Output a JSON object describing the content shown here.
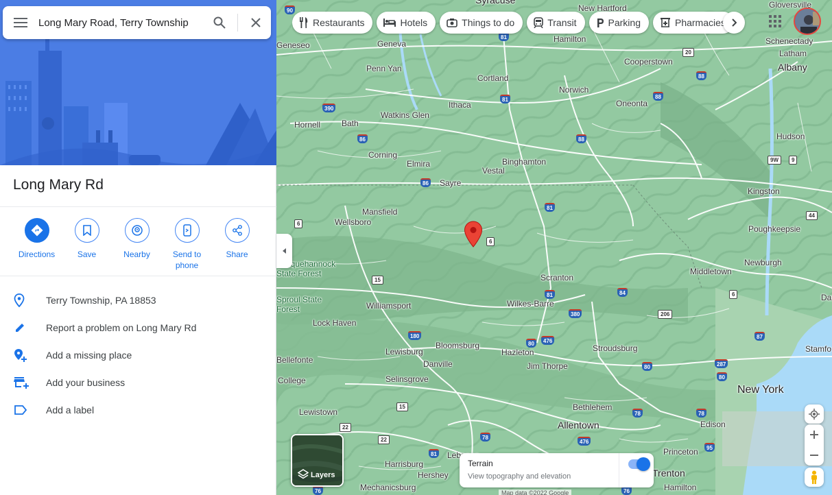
{
  "search": {
    "query": "Long Mary Road, Terry Township"
  },
  "place": {
    "title": "Long Mary Rd",
    "actions": [
      {
        "label": "Directions",
        "icon": "directions-icon"
      },
      {
        "label": "Save",
        "icon": "bookmark-icon"
      },
      {
        "label": "Nearby",
        "icon": "nearby-icon"
      },
      {
        "label": "Send to phone",
        "icon": "phone-icon"
      },
      {
        "label": "Share",
        "icon": "share-icon"
      }
    ],
    "info": [
      {
        "text": "Terry Township, PA 18853",
        "icon": "location-pin-icon"
      },
      {
        "text": "Report a problem on Long Mary Rd",
        "icon": "edit-pencil-icon"
      },
      {
        "text": "Add a missing place",
        "icon": "add-place-icon"
      },
      {
        "text": "Add your business",
        "icon": "add-business-icon"
      },
      {
        "text": "Add a label",
        "icon": "label-icon"
      }
    ]
  },
  "chips": [
    {
      "label": "Restaurants",
      "icon": "restaurant-icon"
    },
    {
      "label": "Hotels",
      "icon": "hotel-icon"
    },
    {
      "label": "Things to do",
      "icon": "camera-icon"
    },
    {
      "label": "Transit",
      "icon": "transit-icon"
    },
    {
      "label": "Parking",
      "icon": "parking-icon"
    },
    {
      "label": "Pharmacies",
      "icon": "pharmacy-icon"
    }
  ],
  "map": {
    "layers_label": "Layers",
    "terrain": {
      "title": "Terrain",
      "subtitle": "View topography and elevation",
      "enabled": true
    },
    "attribution": "Map data ©2022 Google",
    "places": [
      {
        "name": "Syracuse",
        "size": "med"
      },
      {
        "name": "New Hartford",
        "size": "small"
      },
      {
        "name": "Gloversville",
        "size": "small"
      },
      {
        "name": "Geneseo",
        "size": "small"
      },
      {
        "name": "Geneva",
        "size": "small"
      },
      {
        "name": "Hamilton",
        "size": "small"
      },
      {
        "name": "Schenectady",
        "size": "small"
      },
      {
        "name": "Latham",
        "size": "small"
      },
      {
        "name": "Albany",
        "size": "med"
      },
      {
        "name": "Penn Yan",
        "size": "small"
      },
      {
        "name": "Cooperstown",
        "size": "small"
      },
      {
        "name": "Cortland",
        "size": "small"
      },
      {
        "name": "Norwich",
        "size": "small"
      },
      {
        "name": "Ithaca",
        "size": "small"
      },
      {
        "name": "Oneonta",
        "size": "small"
      },
      {
        "name": "Watkins Glen",
        "size": "small"
      },
      {
        "name": "Hornell",
        "size": "small"
      },
      {
        "name": "Bath",
        "size": "small"
      },
      {
        "name": "Hudson",
        "size": "small"
      },
      {
        "name": "Corning",
        "size": "small"
      },
      {
        "name": "Binghamton",
        "size": "small"
      },
      {
        "name": "Elmira",
        "size": "small"
      },
      {
        "name": "Vestal",
        "size": "small"
      },
      {
        "name": "Sayre",
        "size": "small"
      },
      {
        "name": "Kingston",
        "size": "small"
      },
      {
        "name": "Mansfield",
        "size": "small"
      },
      {
        "name": "Wellsboro",
        "size": "small"
      },
      {
        "name": "Poughkeepsie",
        "size": "small"
      },
      {
        "name": "Susquehannock State Forest",
        "size": "green"
      },
      {
        "name": "Newburgh",
        "size": "small"
      },
      {
        "name": "Middletown",
        "size": "small"
      },
      {
        "name": "Scranton",
        "size": "small"
      },
      {
        "name": "Sproul State Forest",
        "size": "green"
      },
      {
        "name": "Williamsport",
        "size": "small"
      },
      {
        "name": "Wilkes-Barre",
        "size": "small"
      },
      {
        "name": "Dan",
        "size": "small"
      },
      {
        "name": "Lock Haven",
        "size": "small"
      },
      {
        "name": "Bloomsburg",
        "size": "small"
      },
      {
        "name": "Stroudsburg",
        "size": "small"
      },
      {
        "name": "Lewisburg",
        "size": "small"
      },
      {
        "name": "Hazleton",
        "size": "small"
      },
      {
        "name": "Stamfo",
        "size": "small"
      },
      {
        "name": "Bellefonte",
        "size": "small"
      },
      {
        "name": "Danville",
        "size": "small"
      },
      {
        "name": "Jim Thorpe",
        "size": "small"
      },
      {
        "name": "College",
        "size": "small"
      },
      {
        "name": "Selinsgrove",
        "size": "small"
      },
      {
        "name": "New York",
        "size": "big"
      },
      {
        "name": "Lewistown",
        "size": "small"
      },
      {
        "name": "Bethlehem",
        "size": "small"
      },
      {
        "name": "Allentown",
        "size": "med"
      },
      {
        "name": "Edison",
        "size": "small"
      },
      {
        "name": "Princeton",
        "size": "small"
      },
      {
        "name": "Lebanon",
        "size": "small"
      },
      {
        "name": "Harrisburg",
        "size": "small"
      },
      {
        "name": "Hershey",
        "size": "small"
      },
      {
        "name": "Trenton",
        "size": "med"
      },
      {
        "name": "Mechanicsburg",
        "size": "small"
      },
      {
        "name": "Hamilton",
        "size": "small"
      }
    ],
    "shields": [
      "90",
      "81",
      "20",
      "390",
      "81",
      "88",
      "88",
      "86",
      "88",
      "9W",
      "9",
      "86",
      "81",
      "6",
      "6",
      "15",
      "81",
      "84",
      "6",
      "380",
      "206",
      "87",
      "44",
      "180",
      "80",
      "476",
      "287",
      "80",
      "80",
      "15",
      "22",
      "78",
      "78",
      "22",
      "95",
      "81",
      "476",
      "76",
      "76",
      "78"
    ]
  },
  "colors": {
    "accent": "#1a73e8",
    "pin": "#ea4335",
    "terrain_green": "#8fc59e"
  }
}
